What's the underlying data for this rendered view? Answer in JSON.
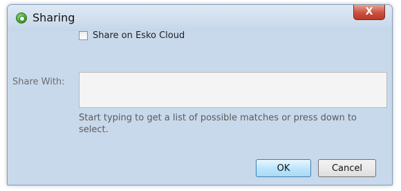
{
  "dialog": {
    "title": "Sharing",
    "close_label": "X"
  },
  "share_cloud": {
    "label": "Share on Esko Cloud",
    "checked": false
  },
  "share_with": {
    "label": "Share With:",
    "value": "",
    "hint": "Start typing to get a list of possible matches or press down to select."
  },
  "buttons": {
    "ok": "OK",
    "cancel": "Cancel"
  },
  "icons": {
    "app": "sharing-app-icon",
    "close": "close-icon"
  }
}
